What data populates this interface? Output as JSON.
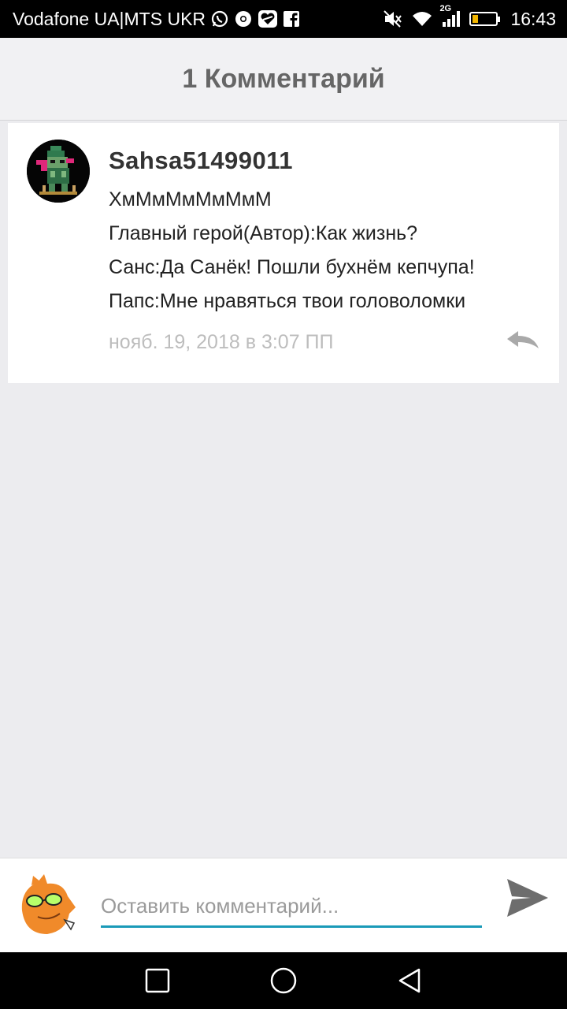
{
  "status_bar": {
    "carrier": "Vodafone UA|MTS UKR",
    "network_type": "2G",
    "time": "16:43",
    "icons": [
      "whatsapp-icon",
      "chrome-icon",
      "heart-app-icon",
      "facebook-icon",
      "mute-icon",
      "wifi-icon",
      "signal-icon",
      "battery-icon"
    ],
    "battery_color": "#f2b600"
  },
  "header": {
    "title": "1 Комментарий"
  },
  "comment": {
    "author": "Sahsa51499011",
    "lines": [
      "ХмМмМмМмМмМ",
      "Главный герой(Автор):Как жизнь?",
      "Санс:Да Санёк! Пошли бухнём кепчупа!",
      "Папс:Мне нравяться твои головоломки"
    ],
    "timestamp": "нояб. 19, 2018 в 3:07 ПП"
  },
  "composer": {
    "placeholder": "Оставить комментарий...",
    "accent_color": "#1a9ab8"
  },
  "nav": {
    "buttons": [
      "recents-square-icon",
      "home-circle-icon",
      "back-triangle-icon"
    ]
  }
}
